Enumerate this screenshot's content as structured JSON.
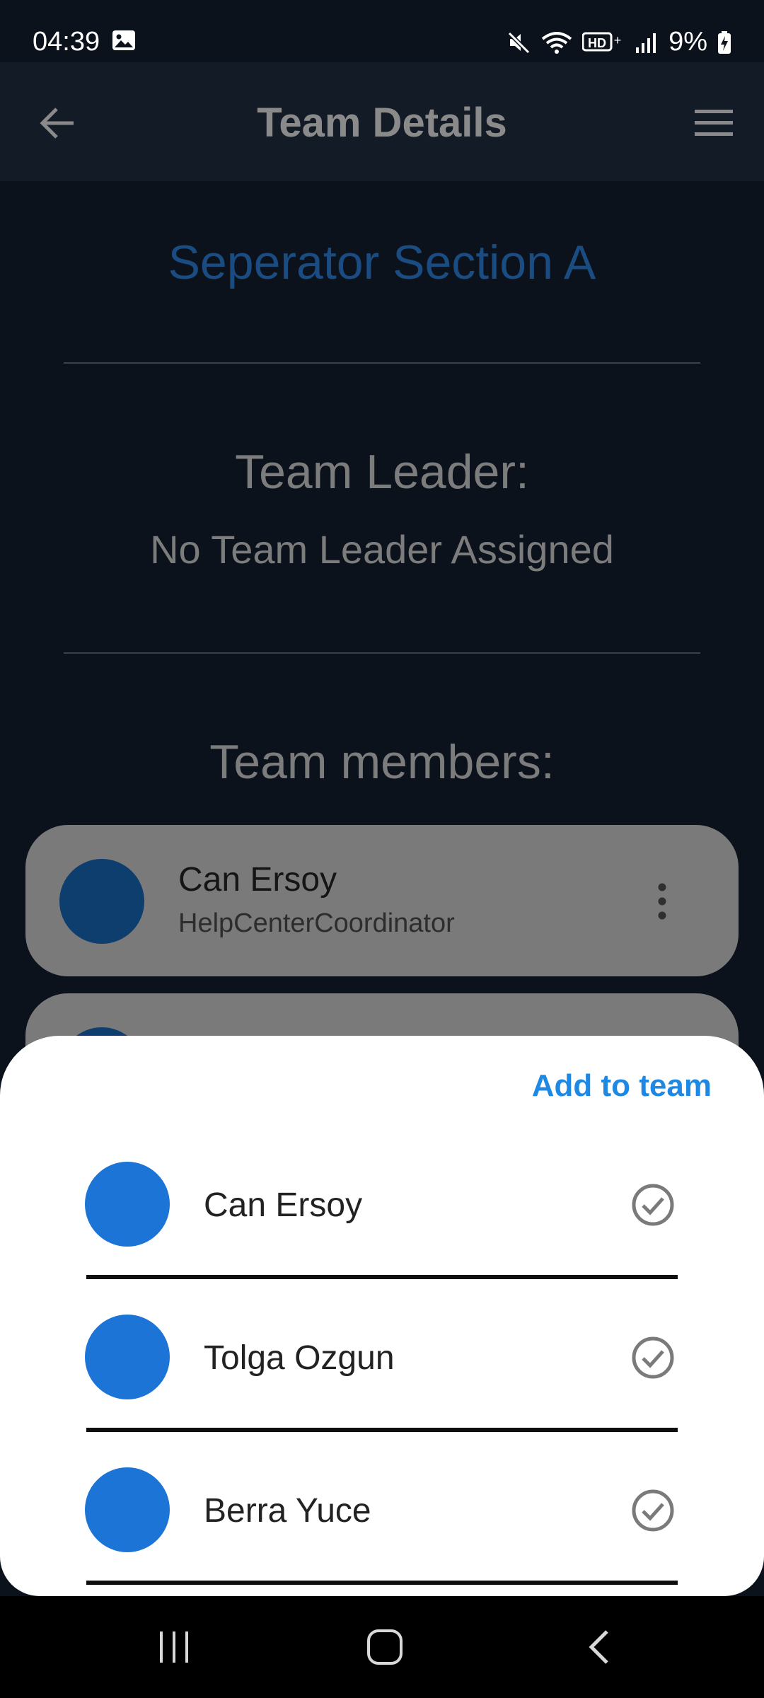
{
  "status_bar": {
    "time": "04:39",
    "battery": "9%",
    "icons": [
      "gallery-icon",
      "mute-icon",
      "wifi-icon",
      "hd-voice-icon",
      "signal-icon",
      "battery-charging-icon"
    ]
  },
  "app_bar": {
    "title": "Team Details",
    "icons": [
      "back-arrow-icon",
      "hamburger-menu-icon"
    ]
  },
  "content": {
    "section_title": "Seperator Section A",
    "leader_label": "Team Leader:",
    "leader_value": "No Team Leader Assigned",
    "members_label": "Team members:",
    "members": [
      {
        "name": "Can Ersoy",
        "role": "HelpCenterCoordinator"
      }
    ]
  },
  "sheet": {
    "action": "Add to team",
    "users": [
      {
        "name": "Can Ersoy"
      },
      {
        "name": "Tolga Ozgun"
      },
      {
        "name": "Berra Yuce"
      }
    ]
  },
  "nav_bar": {
    "icons": [
      "recent-apps-icon",
      "home-icon",
      "back-icon"
    ]
  },
  "colors": {
    "accent": "#1e88e5",
    "avatar": "#1c75d6",
    "background": "#0b121b",
    "app_bar": "#131c26"
  }
}
